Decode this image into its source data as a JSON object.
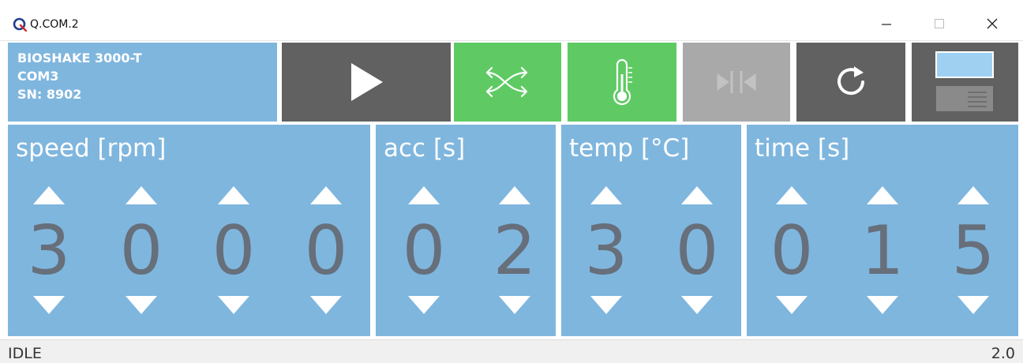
{
  "window": {
    "title": "Q.COM.2",
    "icon": "q-logo-icon",
    "controls": [
      "minimize-icon",
      "maximize-icon",
      "close-icon"
    ]
  },
  "device": {
    "model": "BIOSHAKE 3000-T",
    "port": "COM3",
    "serial": "SN: 8902"
  },
  "toolbar": {
    "buttons": [
      {
        "name": "play",
        "icon": "play-icon",
        "state": "enabled",
        "color": "#616161"
      },
      {
        "name": "shuffle",
        "icon": "shuffle-icon",
        "state": "active",
        "color": "#5fca63"
      },
      {
        "name": "temperature",
        "icon": "thermometer-icon",
        "state": "active",
        "color": "#5fca63"
      },
      {
        "name": "lock",
        "icon": "lock-positions-icon",
        "state": "disabled",
        "color": "#a9a9a9"
      },
      {
        "name": "reset",
        "icon": "reset-icon",
        "state": "enabled",
        "color": "#616161"
      },
      {
        "name": "view",
        "icon": "view-toggle-icon",
        "state": "enabled",
        "color": "#616161"
      }
    ]
  },
  "panels": {
    "speed": {
      "label": "speed [rpm]",
      "digits": [
        "3",
        "0",
        "0",
        "0"
      ]
    },
    "acc": {
      "label": "acc [s]",
      "digits": [
        "0",
        "2"
      ]
    },
    "temp": {
      "label": "temp [°C]",
      "digits": [
        "3",
        "0"
      ]
    },
    "time": {
      "label": "time [s]",
      "digits": [
        "0",
        "1",
        "5"
      ]
    }
  },
  "status": {
    "state": "IDLE",
    "version": "2.0"
  },
  "colors": {
    "panel": "#7fb6de",
    "dark": "#616161",
    "active": "#5fca63",
    "disabled": "#a9a9a9",
    "digit": "#666f7a"
  }
}
